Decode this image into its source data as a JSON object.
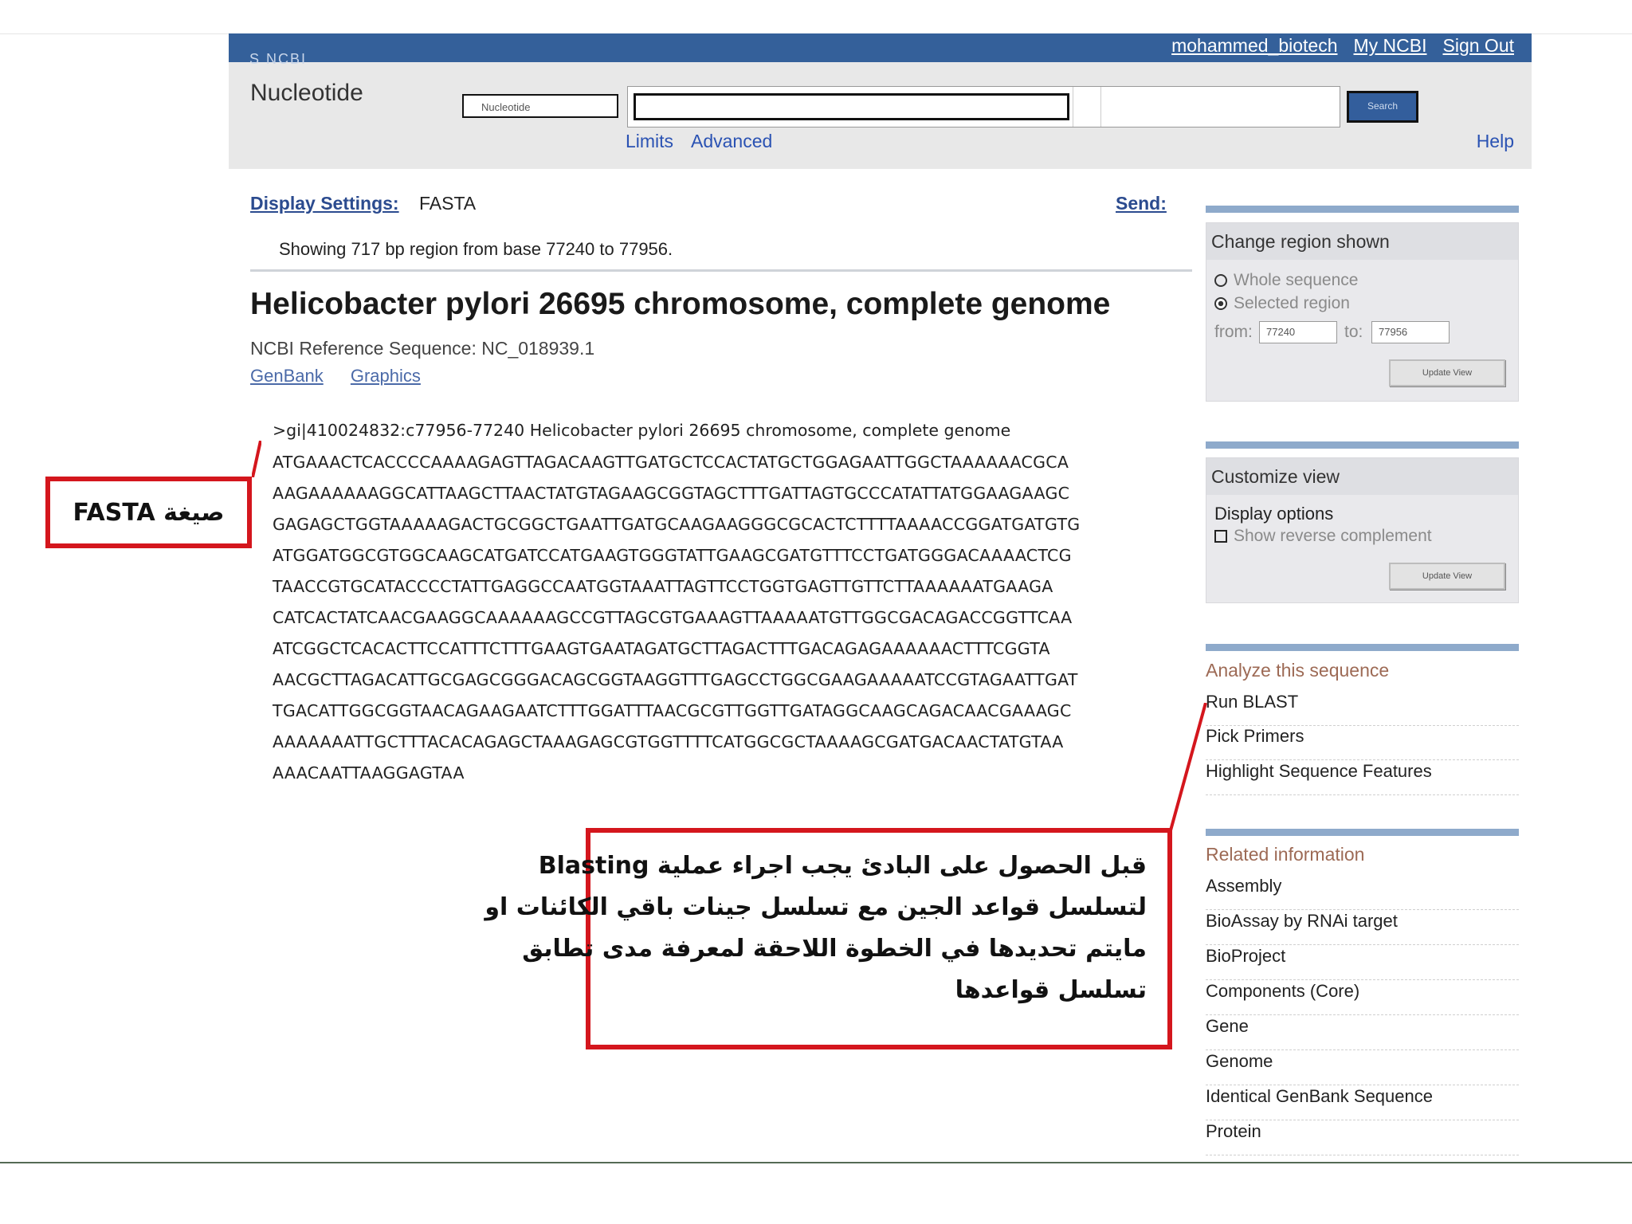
{
  "header": {
    "logo_fragment": "S NCBI",
    "user_links": [
      "mohammed_biotech",
      "My NCBI",
      "Sign Out"
    ],
    "db_name": "Nucleotide",
    "db_select_value": "Nucleotide",
    "search_button": "Search",
    "limits": "Limits",
    "advanced": "Advanced",
    "help": "Help"
  },
  "main": {
    "display_settings": "Display Settings:",
    "format": "FASTA",
    "send": "Send:",
    "showing": "Showing 717 bp region from base 77240 to 77956.",
    "title": "Helicobacter pylori 26695 chromosome, complete genome",
    "refseq": "NCBI Reference Sequence: NC_018939.1",
    "links": [
      "GenBank",
      "Graphics"
    ],
    "fasta_header": ">gi|410024832:c77956-77240 Helicobacter pylori 26695 chromosome, complete genome",
    "sequence_lines": [
      "ATGAAACTCACCCCAAAAGAGTTAGACAAGTTGATGCTCCACTATGCTGGAGAATTGGCTAAAAAACGCA",
      "AAGAAAAAAGGCATTAAGCTTAACTATGTAGAAGCGGTAGCTTTGATTAGTGCCCATATTATGGAAGAAGC",
      "GAGAGCTGGTAAAAAGACTGCGGCTGAATTGATGCAAGAAGGGCGCACTCTTTTAAAACCGGATGATGTG",
      "ATGGATGGCGTGGCAAGCATGATCCATGAAGTGGGTATTGAAGCGATGTTTCCTGATGGGACAAAACTCG",
      "TAACCGTGCATACCCCTATTGAGGCCAATGGTAAATTAGTTCCTGGTGAGTTGTTCTTAAAAAATGAAGA",
      "CATCACTATCAACGAAGGCAAAAAAGCCGTTAGCGTGAAAGTTAAAAATGTTGGCGACAGACCGGTTCAA",
      "ATCGGCTCACACTTCCATTTCTTTGAAGTGAATAGATGCTTAGACTTTGACAGAGAAAAAACTTTCGGTA",
      "AACGCTTAGACATTGCGAGCGGGACAGCGGTAAGGTTTGAGCCTGGCGAAGAAAAATCCGTAGAATTGAT",
      "TGACATTGGCGGTAACAGAAGAATCTTTGGATTTAACGCGTTGGTTGATAGGCAAGCAGACAACGAAAGC",
      "AAAAAAATTGCTTTACACAGAGCTAAAGAGCGTGGTTTTCATGGCGCTAAAAGCGATGACAACTATGTAA",
      "AAACAATTAAGGAGTAA"
    ]
  },
  "annotations": {
    "fasta_label": "صيغة FASTA",
    "blast_note_lines": [
      "قبل الحصول على البادئ يجب اجراء عملية Blasting",
      "لتسلسل قواعد الجين مع تسلسل جينات باقي الكائنات او",
      "مايتم تحديدها في الخطوة اللاحقة لمعرفة مدى تطابق",
      "تسلسل قواعدها"
    ]
  },
  "sidebar": {
    "change_region": {
      "title": "Change region shown",
      "whole": "Whole sequence",
      "selected": "Selected region",
      "from_label": "from:",
      "from_value": "77240",
      "to_label": "to:",
      "to_value": "77956",
      "button": "Update View"
    },
    "customize": {
      "title": "Customize view",
      "display_options": "Display options",
      "reverse": "Show reverse complement",
      "button": "Update View"
    },
    "analyze": {
      "title": "Analyze this sequence",
      "items": [
        "Run BLAST",
        "Pick Primers",
        "Highlight Sequence Features"
      ]
    },
    "related": {
      "title": "Related information",
      "items": [
        "Assembly",
        "BioAssay by RNAi target",
        "BioProject",
        "Components (Core)",
        "Gene",
        "Genome",
        "Identical GenBank Sequence",
        "Protein"
      ]
    }
  },
  "colors": {
    "header_bar": "#34609a",
    "link": "#2a52b3",
    "annotation_red": "#d4161d",
    "section_heading": "#9d6a55"
  }
}
